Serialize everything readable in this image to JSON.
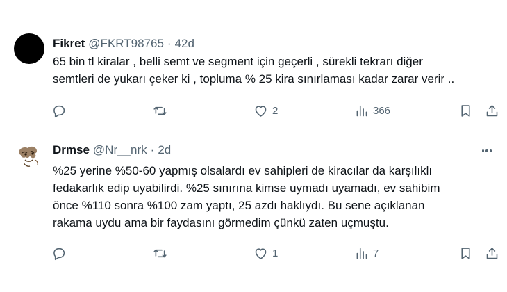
{
  "tweets": [
    {
      "name": "Fikret",
      "handle": "@FKRT98765",
      "separator": "·",
      "time": "42d",
      "text": "65 bin tl kiralar , belli semt ve segment için geçerli , sürekli tekrarı diğer\nsemtleri de yukarı çeker ki , topluma % 25 kira sınırlaması kadar zarar verir ..",
      "replies": "",
      "retweets": "",
      "likes": "2",
      "views": "366",
      "avatar": "black-circle",
      "show_more": false
    },
    {
      "name": "Drmse",
      "handle": "@Nr__nrk",
      "separator": "·",
      "time": "2d",
      "text": "%25 yerine %50-60 yapmış olsalardı ev sahipleri de kiracılar da karşılıklı\nfedakarlık edip uyabilirdi. %25 sınırına kimse uymadı uyamadı, ev sahibim\nönce %110 sonra %100 zam yaptı, 25 azdı haklıydı. Bu sene açıklanan\nrakama uydu ama bir faydasını görmedim çünkü zaten uçmuştu.",
      "replies": "",
      "retweets": "",
      "likes": "1",
      "views": "7",
      "avatar": "sketch-illustration",
      "show_more": true
    }
  ],
  "icons": {
    "reply": "reply-icon",
    "retweet": "retweet-icon",
    "like": "heart-icon",
    "views": "views-chart-icon",
    "bookmark": "bookmark-icon",
    "share": "share-icon",
    "more": "more-dots-icon"
  },
  "colors": {
    "text": "#0f1419",
    "secondary": "#536471",
    "divider": "#eff3f4",
    "background": "#ffffff"
  }
}
